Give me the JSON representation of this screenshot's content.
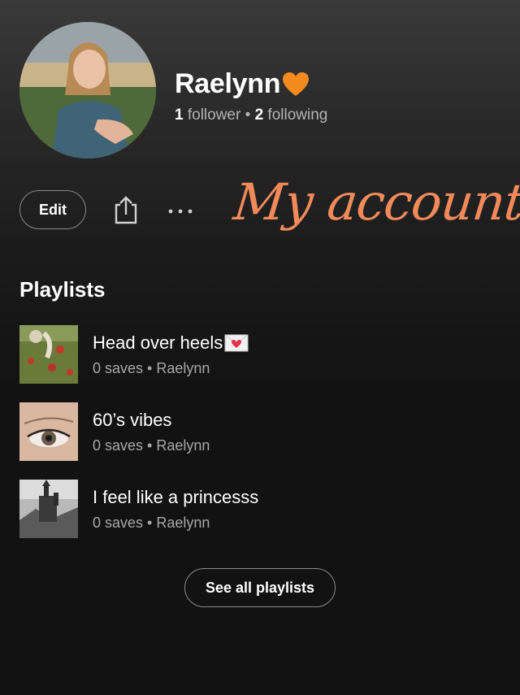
{
  "profile": {
    "name": "Raelynn",
    "name_emoji_icon": "orange-heart-icon",
    "followers_count": "1",
    "followers_label": "follower",
    "separator": "•",
    "following_count": "2",
    "following_label": "following",
    "avatar_icon": "profile-photo"
  },
  "actions": {
    "edit_label": "Edit",
    "share_icon": "share-icon",
    "more_icon": "more-options-icon"
  },
  "overlay": {
    "text": "My account",
    "color": "#f08a5a"
  },
  "playlists": {
    "title": "Playlists",
    "items": [
      {
        "title": "Head over heels",
        "title_emoji_icon": "love-letter-icon",
        "subtitle": "0 saves • Raelynn"
      },
      {
        "title": "60’s vibes",
        "subtitle": "0 saves • Raelynn"
      },
      {
        "title": "I feel like a princesss",
        "subtitle": "0 saves • Raelynn"
      }
    ],
    "see_all_label": "See all playlists"
  },
  "colors": {
    "background": "#121212",
    "secondary_text": "#b3b3b3",
    "accent_heart": "#f58a1f"
  }
}
